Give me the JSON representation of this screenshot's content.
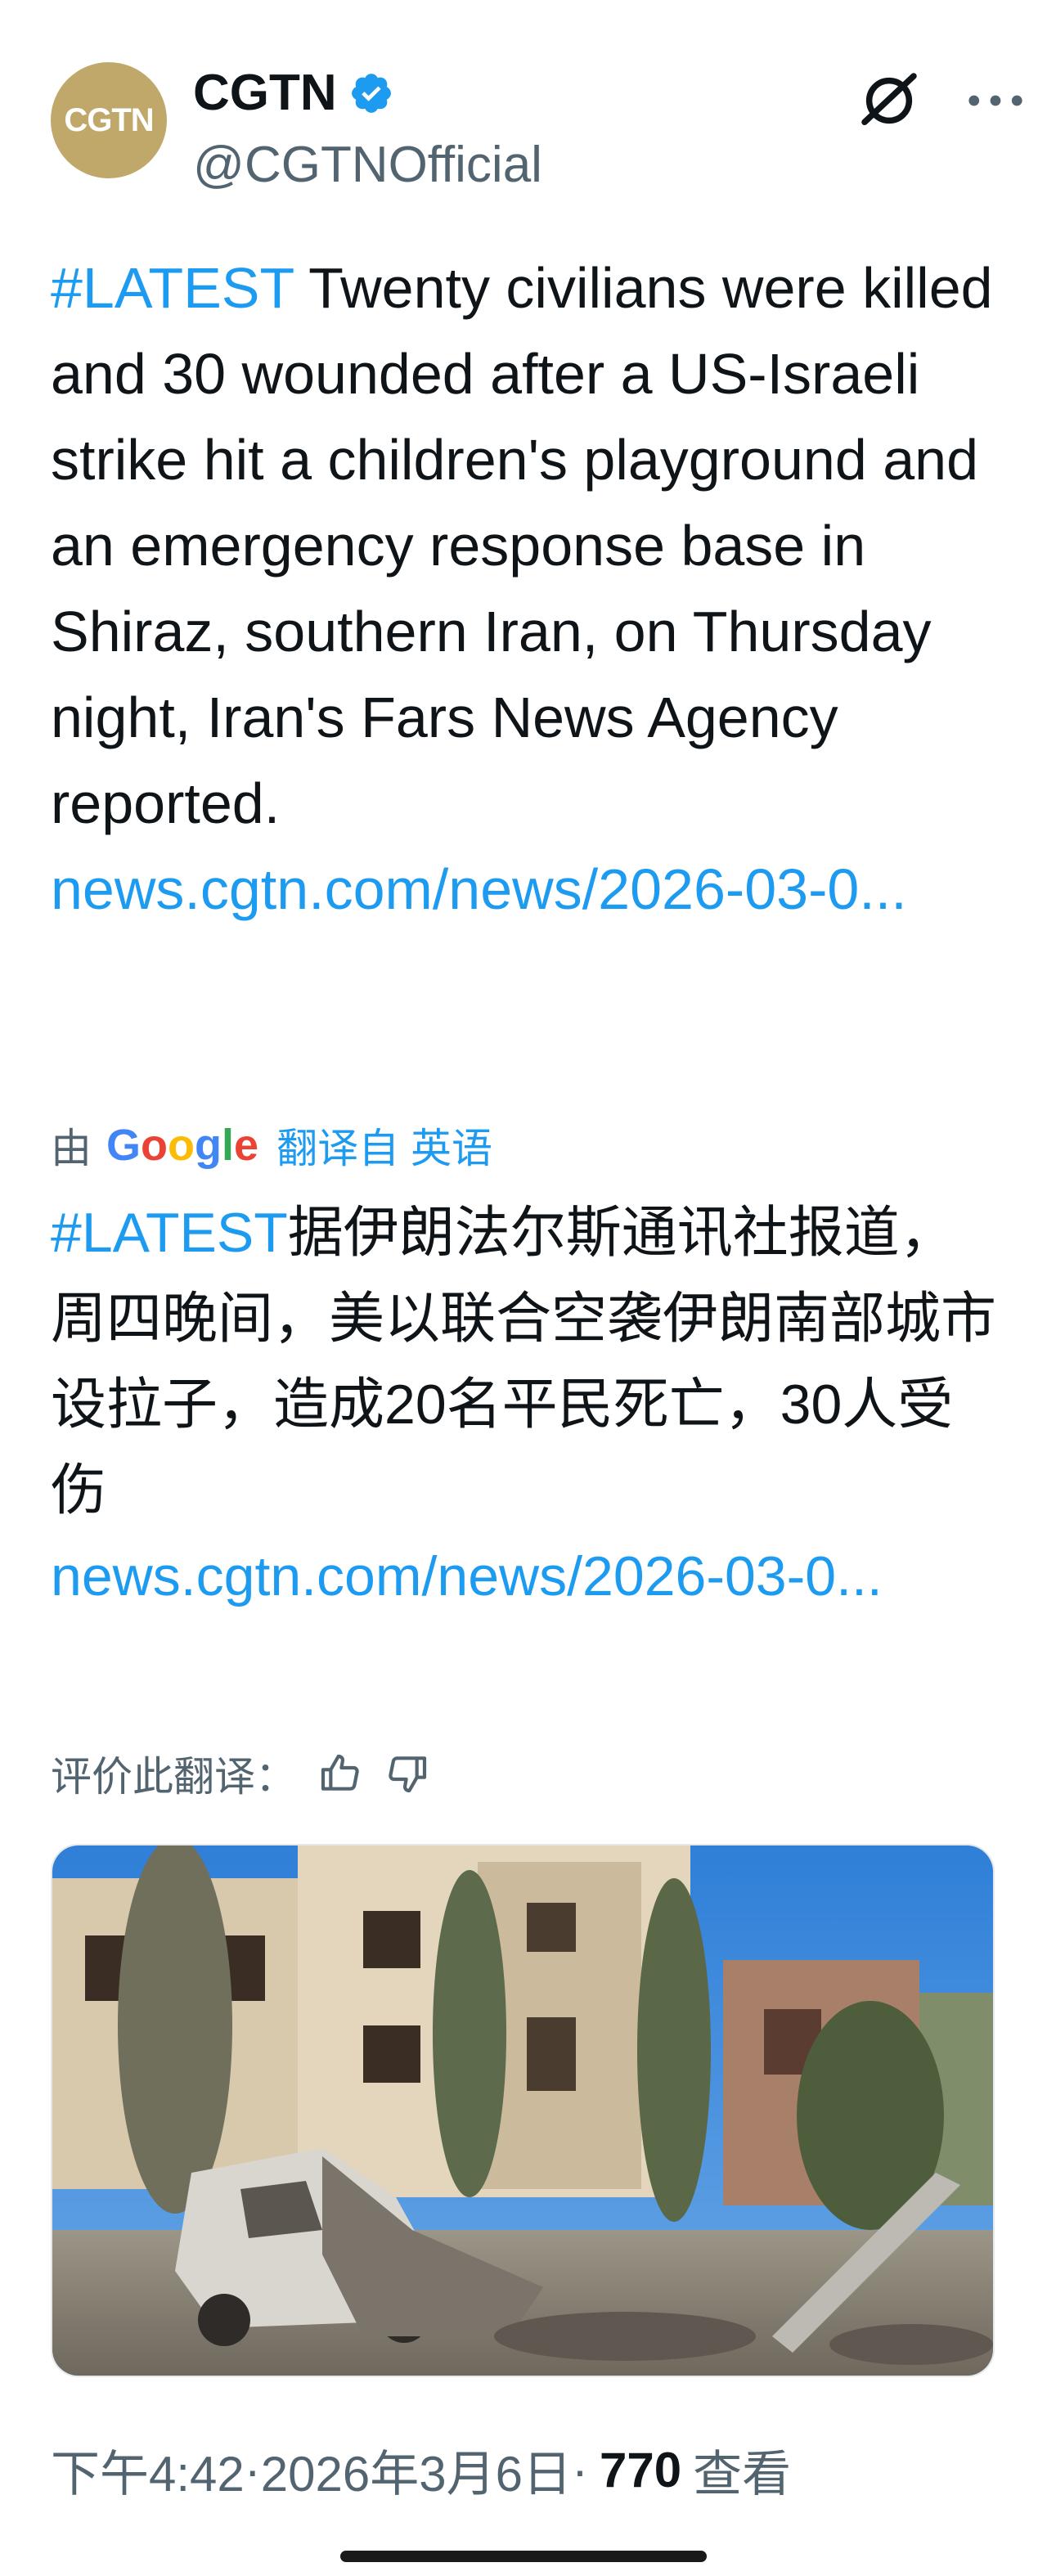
{
  "author": {
    "avatar_text": "CGTN",
    "display_name": "CGTN",
    "handle": "@CGTNOfficial",
    "verified": true
  },
  "header_icons": [
    "grok-icon",
    "more-icon"
  ],
  "tweet": {
    "hashtag": "#LATEST",
    "body": " Twenty civilians were killed and 30 wounded after a US-Israeli strike hit a children's playground and an emergency response base in Shiraz, southern Iran, on Thursday night, Iran's Fars News Agency reported.",
    "link": "news.cgtn.com/news/2026-03-0..."
  },
  "translation": {
    "prefix": "由",
    "google_letters": [
      "G",
      "o",
      "o",
      "g",
      "l",
      "e"
    ],
    "suffix": "翻译自 英语",
    "hashtag": "#LATEST",
    "body": "据伊朗法尔斯通讯社报道，周四晚间，美以联合空袭伊朗南部城市设拉子，造成20名平民死亡，30人受伤",
    "link": "news.cgtn.com/news/2026-03-0...",
    "rate_label": "评价此翻译："
  },
  "media": {
    "alt": "photo"
  },
  "meta": {
    "time": "下午4:42",
    "separator": " · ",
    "date": "2026年3月6日",
    "views": "770",
    "views_label": "查看"
  },
  "colors": {
    "link": "#1d9bf0",
    "secondary_text": "#536471",
    "verified": "#1d9bf0",
    "avatar_bg": "#bfa86a"
  }
}
